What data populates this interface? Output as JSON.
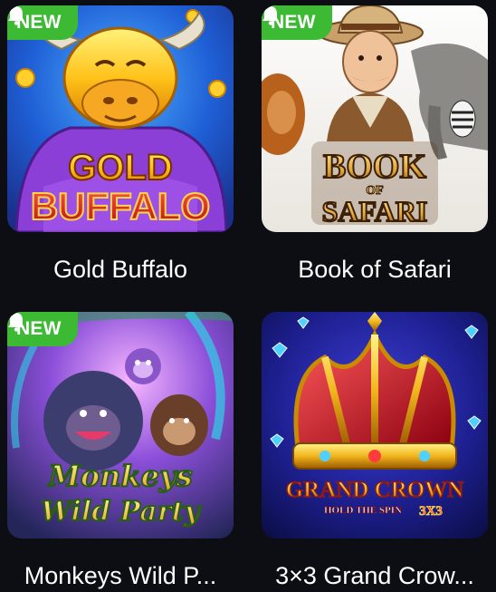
{
  "badge_label": "NEW",
  "games": [
    {
      "title": "Gold Buffalo",
      "logo_lines": [
        "GOLD",
        "BUFFALO"
      ],
      "is_new": true
    },
    {
      "title": "Book of Safari",
      "logo_lines": [
        "BOOK",
        "OF",
        "SAFARI"
      ],
      "is_new": true
    },
    {
      "title": "Monkeys Wild P...",
      "logo_lines": [
        "Monkeys",
        "Wild Party"
      ],
      "is_new": true
    },
    {
      "title": "3×3 Grand Crow...",
      "logo_lines": [
        "GRAND CROWN",
        "HOLD THE SPIN",
        "3X3"
      ],
      "is_new": false
    }
  ],
  "colors": {
    "badge": "#3dba34",
    "background": "#0d0e13",
    "text": "#ffffff"
  },
  "icons": {
    "badge": "bell-icon"
  }
}
